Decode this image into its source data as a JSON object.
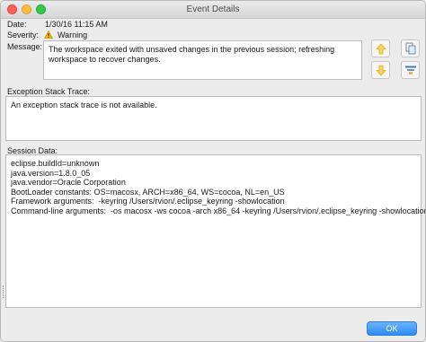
{
  "window": {
    "title": "Event Details"
  },
  "fields": {
    "date_label": "Date:",
    "date_value": "1/30/16 11:15 AM",
    "severity_label": "Severity:",
    "severity_value": "Warning",
    "message_label": "Message:",
    "message_value": "The workspace exited with unsaved changes in the previous session; refreshing workspace to recover changes."
  },
  "exception": {
    "label": "Exception Stack Trace:",
    "text": "An exception stack trace is not available."
  },
  "session": {
    "label": "Session Data:",
    "lines": [
      "eclipse.buildId=unknown",
      "java.version=1.8.0_05",
      "java.vendor=Oracle Corporation",
      "BootLoader constants: OS=macosx, ARCH=x86_64, WS=cocoa, NL=en_US",
      "Framework arguments:  -keyring /Users/rvion/.eclipse_keyring -showlocation",
      "Command-line arguments:  -os macosx -ws cocoa -arch x86_64 -keyring /Users/rvion/.eclipse_keyring -showlocation"
    ]
  },
  "buttons": {
    "ok_label": "OK"
  },
  "icons": {
    "warning": "warning-triangle-icon",
    "previous": "arrow-up-icon",
    "next": "arrow-down-icon",
    "copy": "copy-icon",
    "filter": "filter-icon"
  },
  "colors": {
    "warning": "#f5b400",
    "ok_button": "#2d8cf0",
    "arrow": "#e8b100"
  }
}
